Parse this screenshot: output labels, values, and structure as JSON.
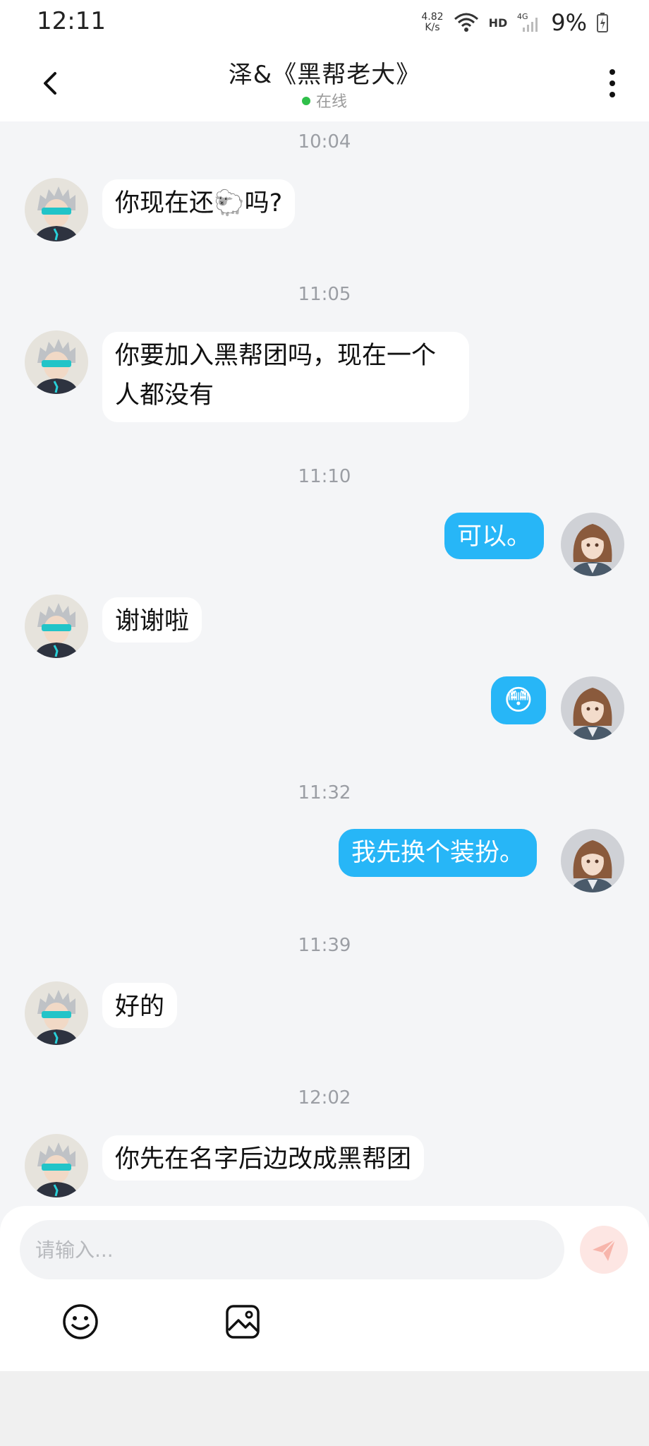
{
  "status_bar": {
    "time": "12:11",
    "speed_value": "4.82",
    "speed_unit": "K/s",
    "hd": "HD",
    "network": "4G",
    "battery": "9%"
  },
  "header": {
    "title": "泽&《黑帮老大》",
    "status": "在线"
  },
  "messages": {
    "ts0": "10:04",
    "m0": "你现在还🐑吗?",
    "ts1": "11:05",
    "m1_line1": "你要加入黑帮团吗，现在一个",
    "m1_line2": "人都没有",
    "ts2": "11:10",
    "m2": "可以。",
    "m3": "谢谢啦",
    "m4": "😳",
    "ts3": "11:32",
    "m5": "我先换个装扮。",
    "ts4": "11:39",
    "m6": "好的",
    "ts5": "12:02",
    "m7": "你先在名字后边改成黑帮团"
  },
  "composer": {
    "placeholder": "请输入..."
  },
  "colors": {
    "outgoing_bubble": "#27b6f7",
    "incoming_bubble": "#ffffff",
    "online_dot": "#2fbf4a",
    "send_button": "#fde6e3"
  },
  "icons": {
    "back": "chevron-left-icon",
    "more": "more-vertical-icon",
    "emoji": "emoji-icon",
    "image": "image-icon",
    "send": "send-icon"
  }
}
